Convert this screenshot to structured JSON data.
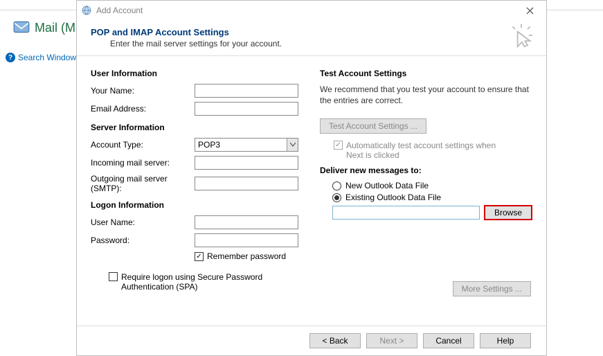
{
  "bg": {
    "title": "Mail (M",
    "help_link": "Search Window"
  },
  "dialog": {
    "title": "Add Account",
    "heading": "POP and IMAP Account Settings",
    "subheading": "Enter the mail server settings for your account."
  },
  "left": {
    "user_info_head": "User Information",
    "your_name_label": "Your Name:",
    "email_label": "Email Address:",
    "server_info_head": "Server Information",
    "account_type_label": "Account Type:",
    "account_type_value": "POP3",
    "incoming_label": "Incoming mail server:",
    "outgoing_label": "Outgoing mail server (SMTP):",
    "logon_head": "Logon Information",
    "user_label": "User Name:",
    "pass_label": "Password:",
    "remember_label": "Remember password",
    "spa_label": "Require logon using Secure Password Authentication (SPA)"
  },
  "right": {
    "test_head": "Test Account Settings",
    "test_text": "We recommend that you test your account to ensure that the entries are correct.",
    "test_button": "Test Account Settings ...",
    "auto_test_label": "Automatically test account settings when Next is clicked",
    "deliver_head": "Deliver new messages to:",
    "new_file_label": "New Outlook Data File",
    "existing_file_label": "Existing Outlook Data File",
    "browse_label": "Browse",
    "more_settings_label": "More Settings ..."
  },
  "footer": {
    "back": "< Back",
    "next": "Next >",
    "cancel": "Cancel",
    "help": "Help"
  }
}
